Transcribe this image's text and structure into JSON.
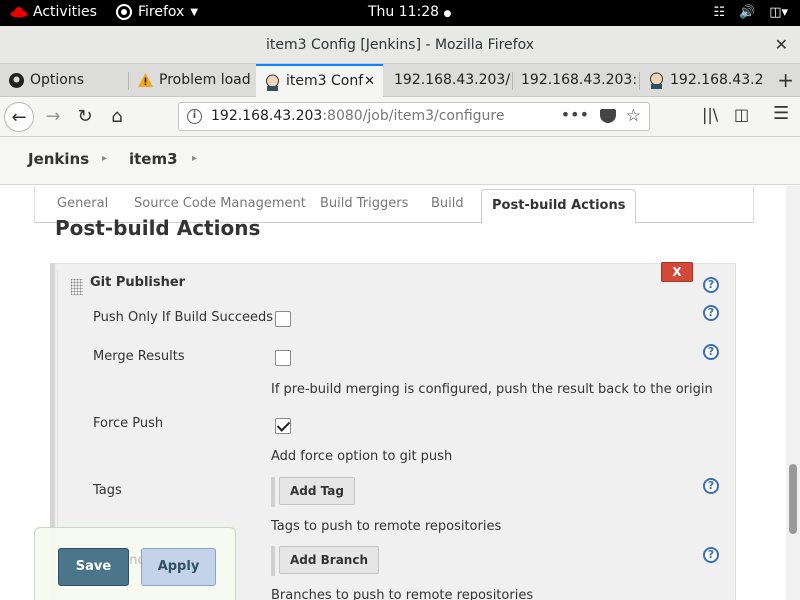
{
  "system_bar": {
    "activities": "Activities",
    "app_menu": "Firefox",
    "clock": "Thu 11:28"
  },
  "window": {
    "title": "item3 Config [Jenkins] - Mozilla Firefox"
  },
  "tabs": [
    {
      "label": "Options",
      "icon": "github-icon"
    },
    {
      "label": "Problem load",
      "icon": "warning-icon"
    },
    {
      "label": "item3 Conf",
      "icon": "jenkins-icon",
      "active": true
    },
    {
      "label": "192.168.43.203/",
      "icon": ""
    },
    {
      "label": "192.168.43.203:",
      "icon": ""
    },
    {
      "label": "192.168.43.2",
      "icon": "jenkins-icon"
    }
  ],
  "navbar": {
    "url_host": "192.168.43.203",
    "url_rest": ":8080/job/item3/configure"
  },
  "breadcrumb": {
    "root": "Jenkins",
    "item": "item3"
  },
  "config_tabs": [
    "General",
    "Source Code Management",
    "Build Triggers",
    "Build",
    "Post-build Actions"
  ],
  "section": {
    "title": "Post-build Actions"
  },
  "git_publisher": {
    "title": "Git Publisher",
    "delete_label": "X",
    "push_only_label": "Push Only If Build Succeeds",
    "push_only_checked": false,
    "merge_results_label": "Merge Results",
    "merge_results_checked": false,
    "merge_results_desc": "If pre-build merging is configured, push the result back to the origin",
    "force_push_label": "Force Push",
    "force_push_checked": true,
    "force_push_desc": "Add force option to git push",
    "tags_label": "Tags",
    "add_tag_label": "Add Tag",
    "tags_desc": "Tags to push to remote repositories",
    "branches_partial_label": "Branche",
    "add_branch_label": "Add Branch",
    "branches_desc": "Branches to push to remote repositories"
  },
  "actions": {
    "save": "Save",
    "apply": "Apply"
  },
  "colors": {
    "tab_accent": "#0a84ff",
    "delete_red": "#d24939",
    "save_blue": "#4b758b",
    "apply_blue": "#c2d3ea",
    "help_blue": "#3c6eb4"
  }
}
